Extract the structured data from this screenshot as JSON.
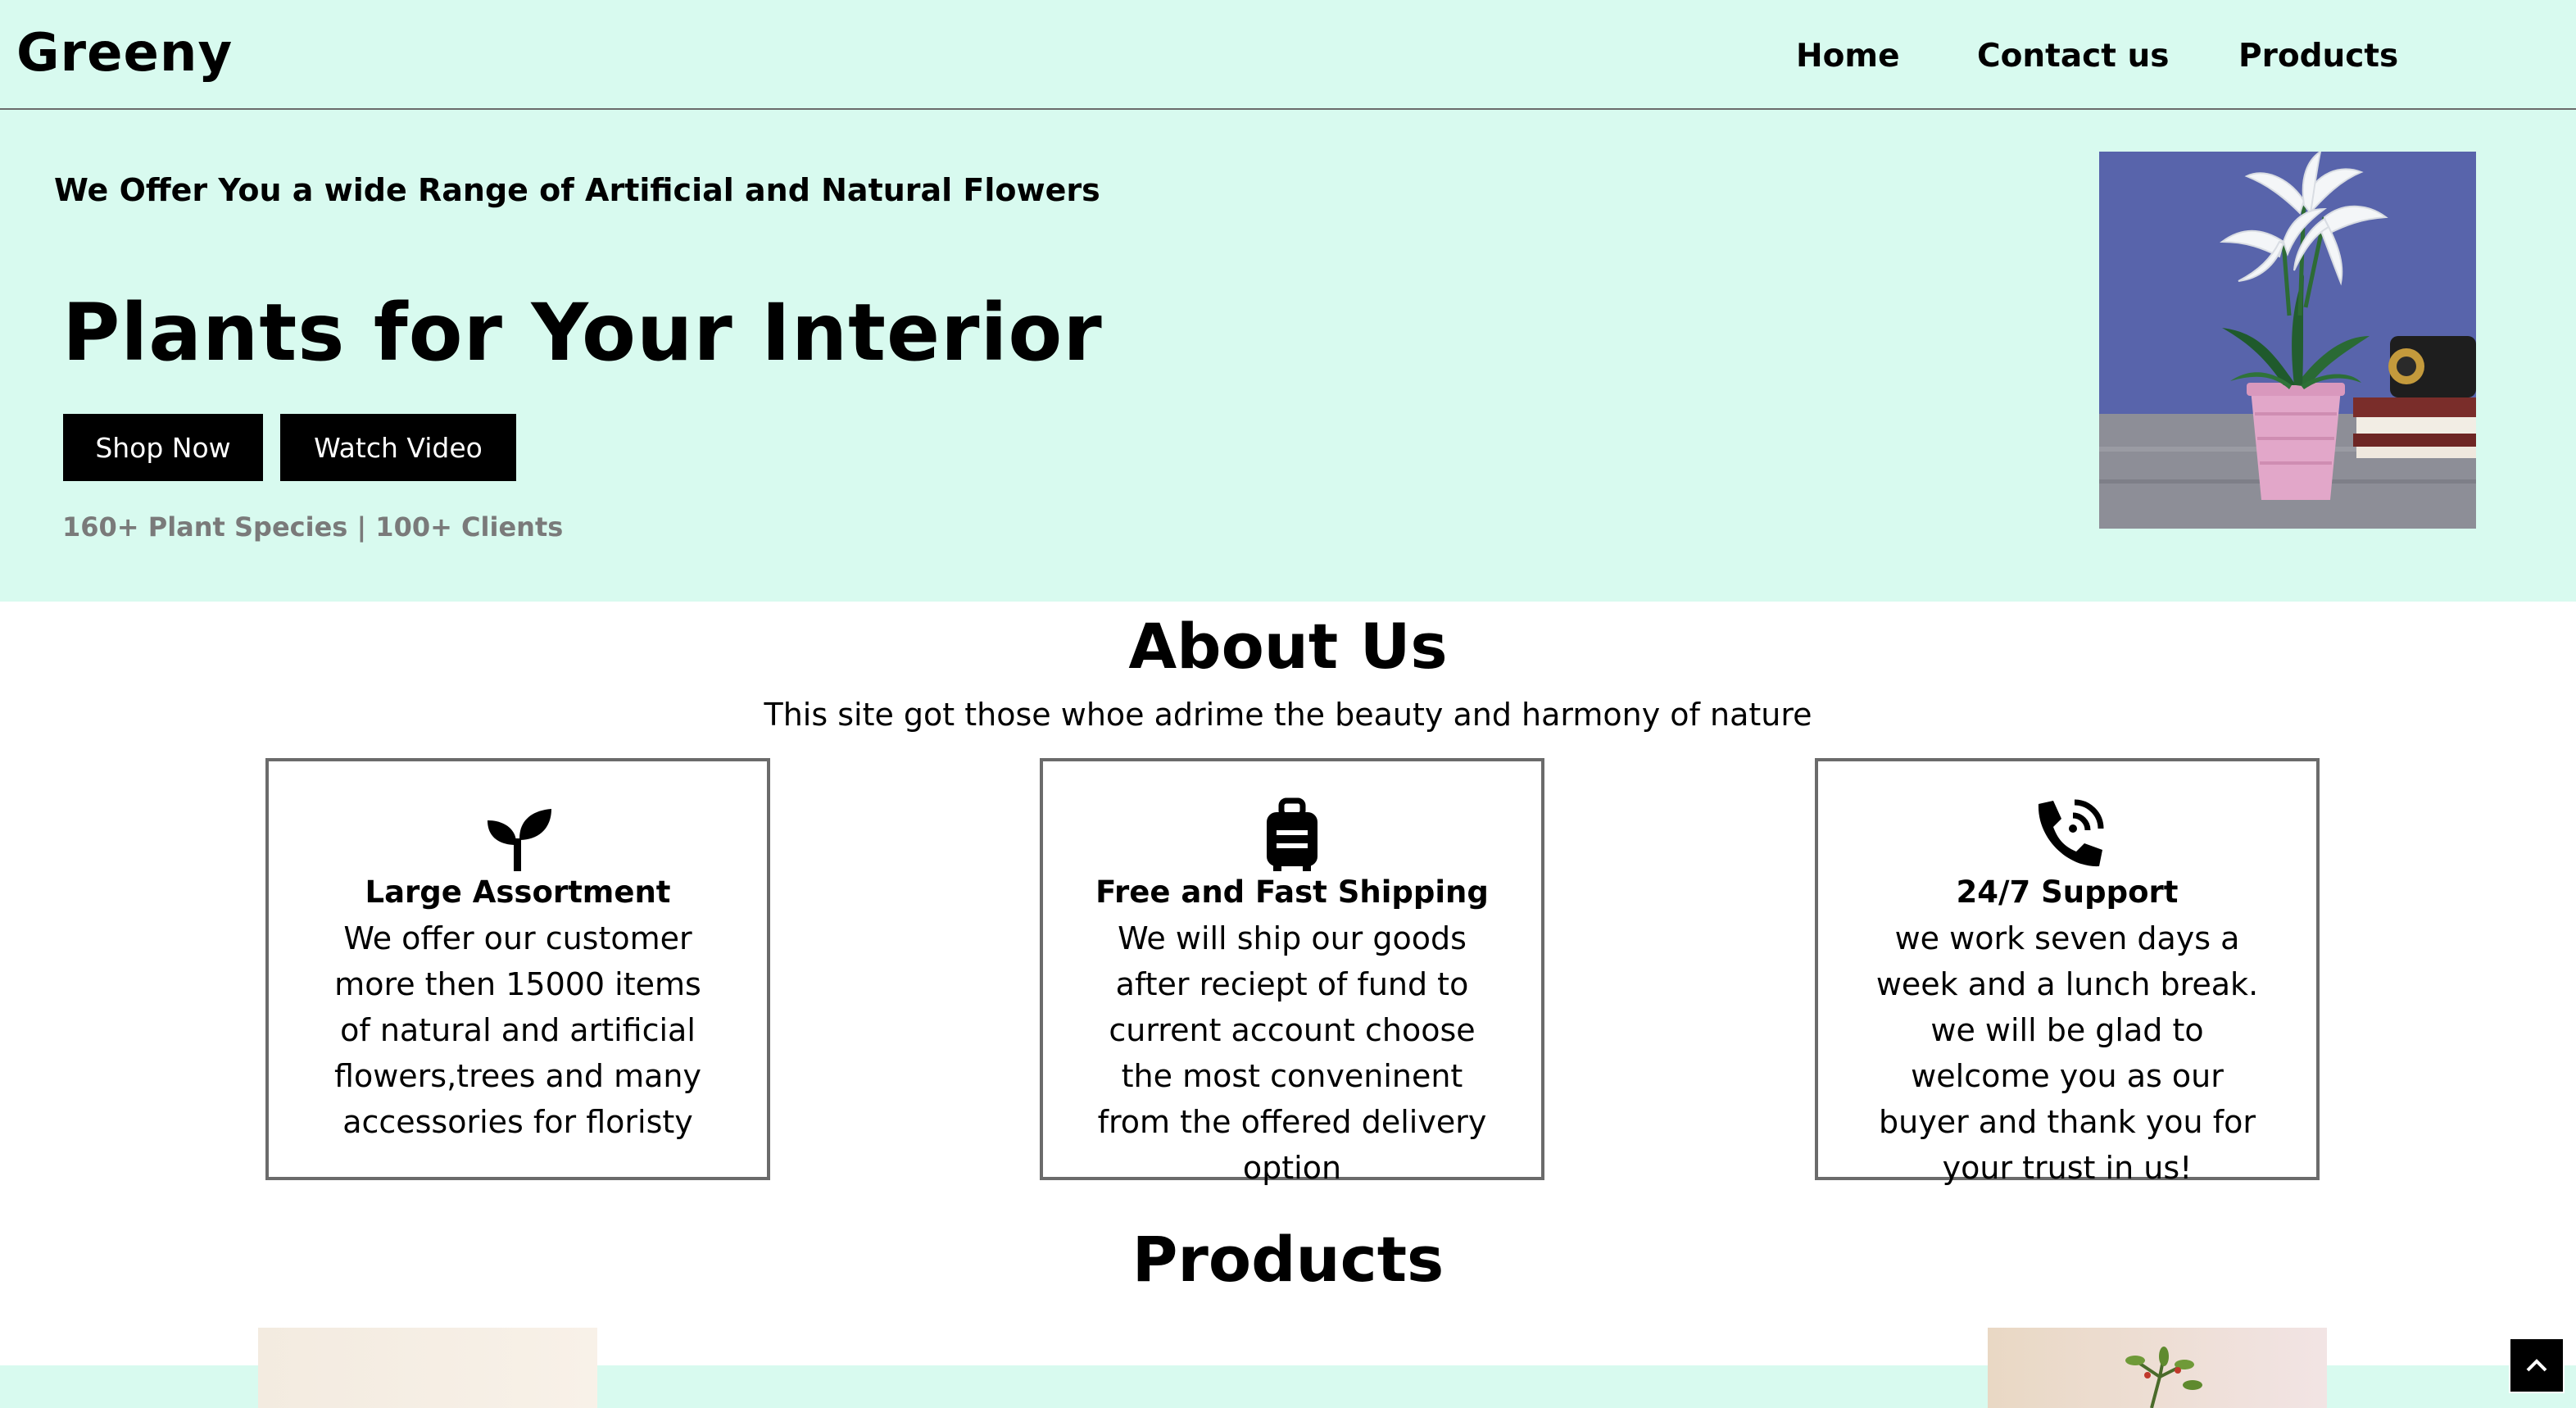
{
  "header": {
    "logo": "Greeny",
    "nav": [
      {
        "label": "Home"
      },
      {
        "label": "Contact us"
      },
      {
        "label": "Products"
      }
    ]
  },
  "hero": {
    "tagline": "We Offer You a wide Range of Artificial and Natural Flowers",
    "headline": "Plants for Your Interior",
    "shop_button": "Shop Now",
    "video_button": "Watch Video",
    "stats": "160+ Plant Species | 100+ Clients",
    "image_icon": "potted-lily-photo"
  },
  "about": {
    "title": "About Us",
    "subtitle": "This site got those whoe adrime the beauty and harmony of nature",
    "cards": [
      {
        "icon": "sprout-icon",
        "title": "Large Assortment",
        "text": "We offer our customer more then 15000 items of natural and artificial flowers,trees and many accessories for floristy"
      },
      {
        "icon": "luggage-icon",
        "title": "Free and Fast Shipping",
        "text": "We will ship our goods after reciept of fund to current account choose the most conveninent from the offered delivery option"
      },
      {
        "icon": "phone-call-icon",
        "title": "24/7 Support",
        "text": "we work seven days a week and a lunch break. we will be glad to welcome you as our buyer and thank you for your trust in us!"
      }
    ]
  },
  "products": {
    "title": "Products"
  },
  "colors": {
    "mint_background": "#d8faef",
    "button_black": "#000000",
    "stats_gray": "#7a7a7a",
    "card_border": "#6b6b6b"
  }
}
